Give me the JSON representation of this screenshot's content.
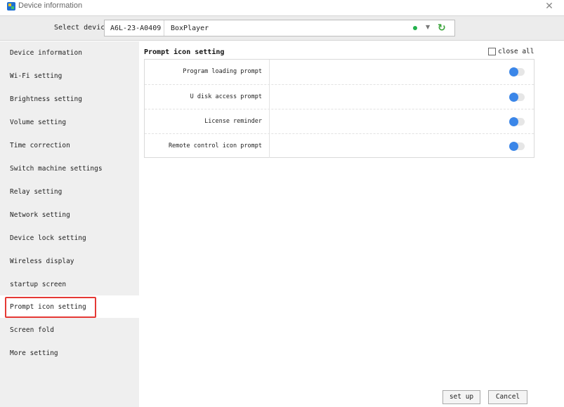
{
  "window": {
    "title": "Device information",
    "close_icon": "close-icon"
  },
  "device": {
    "label": "Select device:",
    "id": "A6L-23-A0409",
    "name": "BoxPlayer",
    "status_color": "#22b14c"
  },
  "sidebar": {
    "items": [
      {
        "label": "Device information"
      },
      {
        "label": "Wi-Fi setting"
      },
      {
        "label": "Brightness setting"
      },
      {
        "label": "Volume setting"
      },
      {
        "label": "Time correction"
      },
      {
        "label": "Switch machine settings"
      },
      {
        "label": "Relay setting"
      },
      {
        "label": "Network setting"
      },
      {
        "label": "Device lock setting"
      },
      {
        "label": "Wireless display"
      },
      {
        "label": "startup screen"
      },
      {
        "label": "Prompt icon setting",
        "active": true
      },
      {
        "label": "Screen fold"
      },
      {
        "label": "More setting"
      }
    ]
  },
  "main": {
    "section_title": "Prompt icon setting",
    "close_all_label": "close all",
    "close_all_checked": false,
    "rows": [
      {
        "label": "Program loading prompt",
        "enabled": false
      },
      {
        "label": "U disk access prompt",
        "enabled": false
      },
      {
        "label": "License reminder",
        "enabled": false
      },
      {
        "label": "Remote control icon prompt",
        "enabled": false
      }
    ],
    "toggle_color": "#3b86e8"
  },
  "buttons": {
    "setup": "set up",
    "cancel": "Cancel"
  }
}
